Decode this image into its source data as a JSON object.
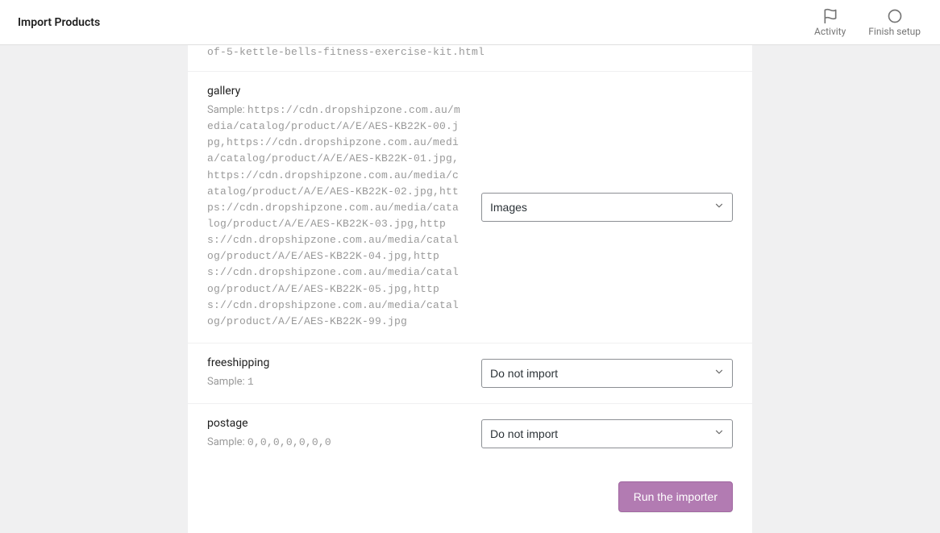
{
  "header": {
    "title": "Import Products",
    "actions": {
      "activity": "Activity",
      "finish_setup": "Finish setup"
    }
  },
  "partial_top": {
    "text": "of-5-kettle-bells-fitness-exercise-kit.html"
  },
  "fields": [
    {
      "name": "gallery",
      "sample_prefix": "Sample: ",
      "sample_value": "https://cdn.dropshipzone.com.au/media/catalog/product/A/E/AES-KB22K-00.jpg,https://cdn.dropshipzone.com.au/media/catalog/product/A/E/AES-KB22K-01.jpg,https://cdn.dropshipzone.com.au/media/catalog/product/A/E/AES-KB22K-02.jpg,https://cdn.dropshipzone.com.au/media/catalog/product/A/E/AES-KB22K-03.jpg,https://cdn.dropshipzone.com.au/media/catalog/product/A/E/AES-KB22K-04.jpg,https://cdn.dropshipzone.com.au/media/catalog/product/A/E/AES-KB22K-05.jpg,https://cdn.dropshipzone.com.au/media/catalog/product/A/E/AES-KB22K-99.jpg",
      "select": "Images"
    },
    {
      "name": "freeshipping",
      "sample_prefix": "Sample: ",
      "sample_value": "1",
      "select": "Do not import"
    },
    {
      "name": "postage",
      "sample_prefix": "Sample: ",
      "sample_value": "0,0,0,0,0,0,0",
      "select": "Do not import"
    }
  ],
  "footer": {
    "run_label": "Run the importer"
  }
}
